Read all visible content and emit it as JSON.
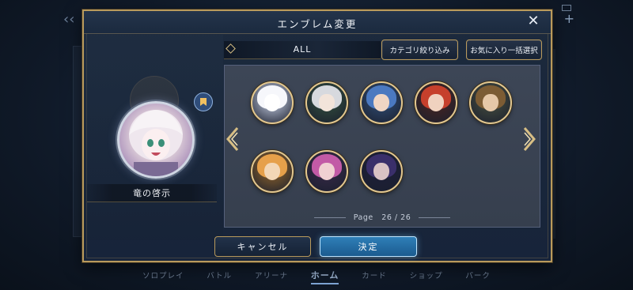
{
  "modal": {
    "title": "エンブレム変更",
    "close_icon": "close-icon"
  },
  "preview": {
    "emblem_name": "竜の啓示",
    "bookmark_icon": "bookmark-icon"
  },
  "filter": {
    "label": "ALL",
    "category_button": "カテゴリ絞り込み",
    "favorite_button": "お気に入り一括選択"
  },
  "grid": {
    "emblems": [
      {
        "name": "emblem-white-mascot",
        "bg": "#cfd8ee",
        "hair": "#f6f7fb",
        "face": "#ffffff"
      },
      {
        "name": "emblem-silver-hair-elf",
        "bg": "#34523f",
        "hair": "#d7d9de",
        "face": "#f2e4da"
      },
      {
        "name": "emblem-blue-hair-boy",
        "bg": "#31507a",
        "hair": "#4b79c0",
        "face": "#f0d6c4"
      },
      {
        "name": "emblem-red-hair-boy",
        "bg": "#4e2620",
        "hair": "#c6402c",
        "face": "#f0d2bf"
      },
      {
        "name": "emblem-brown-hair-man",
        "bg": "#4a5240",
        "hair": "#7c5c34",
        "face": "#e6c8a8"
      },
      {
        "name": "emblem-orange-hair-girl",
        "bg": "#9a6a2a",
        "hair": "#e6a04a",
        "face": "#f3d7b6"
      },
      {
        "name": "emblem-pink-hair-girl",
        "bg": "#3a2a4a",
        "hair": "#c25aa6",
        "face": "#f0d0d2"
      },
      {
        "name": "emblem-dark-hair-mage",
        "bg": "#1e1f3a",
        "hair": "#3a2f6a",
        "face": "#d9c2c4"
      }
    ]
  },
  "pagination": {
    "label": "Page",
    "current": "26",
    "separator": "/",
    "total": "26",
    "prev_icon": "chevron-left-icon",
    "next_icon": "chevron-right-icon"
  },
  "footer": {
    "cancel": "キャンセル",
    "confirm": "決定"
  },
  "bottom_nav": {
    "items": [
      "ソロプレイ",
      "バトル",
      "アリーナ",
      "ホーム",
      "カード",
      "ショップ",
      "パーク"
    ],
    "active": "ホーム"
  },
  "colors": {
    "accent_gold": "#b99a5c",
    "confirm_blue": "#2f7fb8",
    "panel_bg": "#17243a"
  }
}
